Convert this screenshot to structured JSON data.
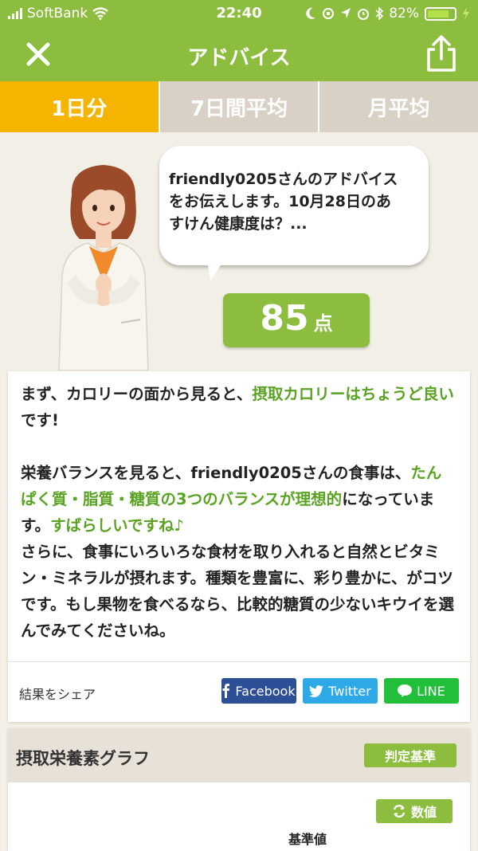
{
  "status_bar": {
    "carrier": "SoftBank",
    "time": "22:40",
    "battery": "82%",
    "battery_level": 0.82
  },
  "nav": {
    "title": "アドバイス"
  },
  "tabs": [
    {
      "label": "1日分",
      "active": true
    },
    {
      "label": "7日間平均",
      "active": false
    },
    {
      "label": "月平均",
      "active": false
    }
  ],
  "advice": {
    "bubble_line1": "friendly0205さんのアドバイス",
    "bubble_line2": "をお伝えします。10月28日のあ",
    "bubble_line3": "すけん健康度は？...",
    "score": "85",
    "score_unit": "点"
  },
  "card": {
    "p1_a": "まず、カロリーの面から見ると、",
    "p1_hl": "摂取カロリーはちょうど良い",
    "p1_b": "です!",
    "p2_a": "栄養バランスを見ると、friendly0205さんの食事は、",
    "p2_hl": "たんぱく質・脂質・糖質の3つのバランスが理想的",
    "p2_b": "になっています。",
    "p2_hl2": "すばらしいですね♪",
    "p3": "さらに、食事にいろいろな食材を取り入れると自然とビタミン・ミネラルが摂れます。種類を豊富に、彩り豊かに、がコツです。もし果物を食べるなら、比較的糖質の少ないキウイを選んでみてくださいね。"
  },
  "share": {
    "label": "結果をシェア",
    "facebook": "Facebook",
    "twitter": "Twitter",
    "line": "LINE"
  },
  "graph": {
    "title": "摂取栄養素グラフ",
    "judge_button": "判定基準",
    "value_button": "数値",
    "reference_label": "基準値"
  },
  "colors": {
    "brand_green": "#8dbd3e",
    "highlight_green": "#5aa322",
    "active_tab": "#f4b400",
    "facebook": "#2c4f97",
    "twitter": "#2ea9e8",
    "line": "#22c03a"
  }
}
